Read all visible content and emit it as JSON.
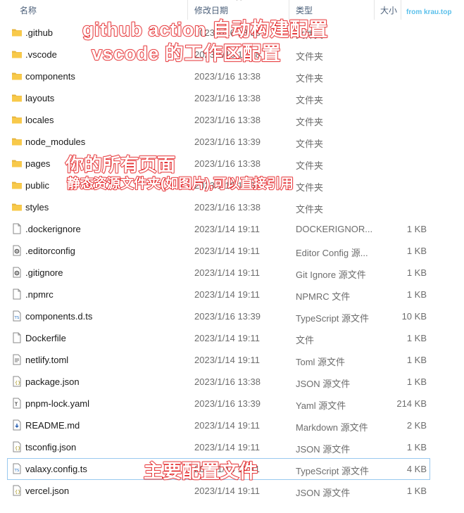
{
  "header": {
    "name": "名称",
    "date": "修改日期",
    "type": "类型",
    "size": "大小"
  },
  "watermark": "from krau.top",
  "files": [
    {
      "name": ".github",
      "date": "2023/1/16 13:38",
      "type": "文件夹",
      "size": "",
      "icon": "folder"
    },
    {
      "name": ".vscode",
      "date": "2023/1/16 13:38",
      "type": "文件夹",
      "size": "",
      "icon": "folder"
    },
    {
      "name": "components",
      "date": "2023/1/16 13:38",
      "type": "文件夹",
      "size": "",
      "icon": "folder"
    },
    {
      "name": "layouts",
      "date": "2023/1/16 13:38",
      "type": "文件夹",
      "size": "",
      "icon": "folder"
    },
    {
      "name": "locales",
      "date": "2023/1/16 13:38",
      "type": "文件夹",
      "size": "",
      "icon": "folder"
    },
    {
      "name": "node_modules",
      "date": "2023/1/16 13:39",
      "type": "文件夹",
      "size": "",
      "icon": "folder"
    },
    {
      "name": "pages",
      "date": "2023/1/16 13:38",
      "type": "文件夹",
      "size": "",
      "icon": "folder"
    },
    {
      "name": "public",
      "date": "2023/1/16 13:38",
      "type": "文件夹",
      "size": "",
      "icon": "folder"
    },
    {
      "name": "styles",
      "date": "2023/1/16 13:38",
      "type": "文件夹",
      "size": "",
      "icon": "folder"
    },
    {
      "name": ".dockerignore",
      "date": "2023/1/14 19:11",
      "type": "DOCKERIGNOR...",
      "size": "1 KB",
      "icon": "file"
    },
    {
      "name": ".editorconfig",
      "date": "2023/1/14 19:11",
      "type": "Editor Config 源...",
      "size": "1 KB",
      "icon": "gear-file"
    },
    {
      "name": ".gitignore",
      "date": "2023/1/14 19:11",
      "type": "Git Ignore 源文件",
      "size": "1 KB",
      "icon": "gear-file"
    },
    {
      "name": ".npmrc",
      "date": "2023/1/14 19:11",
      "type": "NPMRC 文件",
      "size": "1 KB",
      "icon": "file"
    },
    {
      "name": "components.d.ts",
      "date": "2023/1/16 13:39",
      "type": "TypeScript 源文件",
      "size": "10 KB",
      "icon": "ts-file"
    },
    {
      "name": "Dockerfile",
      "date": "2023/1/14 19:11",
      "type": "文件",
      "size": "1 KB",
      "icon": "file"
    },
    {
      "name": "netlify.toml",
      "date": "2023/1/14 19:11",
      "type": "Toml 源文件",
      "size": "1 KB",
      "icon": "text-file"
    },
    {
      "name": "package.json",
      "date": "2023/1/16 13:38",
      "type": "JSON 源文件",
      "size": "1 KB",
      "icon": "json-file"
    },
    {
      "name": "pnpm-lock.yaml",
      "date": "2023/1/16 13:39",
      "type": "Yaml 源文件",
      "size": "214 KB",
      "icon": "yaml-file"
    },
    {
      "name": "README.md",
      "date": "2023/1/14 19:11",
      "type": "Markdown 源文件",
      "size": "2 KB",
      "icon": "md-file"
    },
    {
      "name": "tsconfig.json",
      "date": "2023/1/14 19:11",
      "type": "JSON 源文件",
      "size": "1 KB",
      "icon": "json-file"
    },
    {
      "name": "valaxy.config.ts",
      "date": "2023/1/14 19:11",
      "type": "TypeScript 源文件",
      "size": "4 KB",
      "icon": "ts-file",
      "selected": true
    },
    {
      "name": "vercel.json",
      "date": "2023/1/14 19:11",
      "type": "JSON 源文件",
      "size": "1 KB",
      "icon": "json-file"
    }
  ],
  "annotations": {
    "github_action": "github action 自动构建配置",
    "vscode": "vscode 的工作区配置",
    "pages": "你的所有页面",
    "public": "静态资源文件夹(如图片),可以直接引用",
    "config": "主要配置文件"
  },
  "colors": {
    "folder": "#f8c94a",
    "annotation_stroke": "#e8232a",
    "selection_border": "#99c9ef",
    "watermark": "#5bc0eb"
  }
}
